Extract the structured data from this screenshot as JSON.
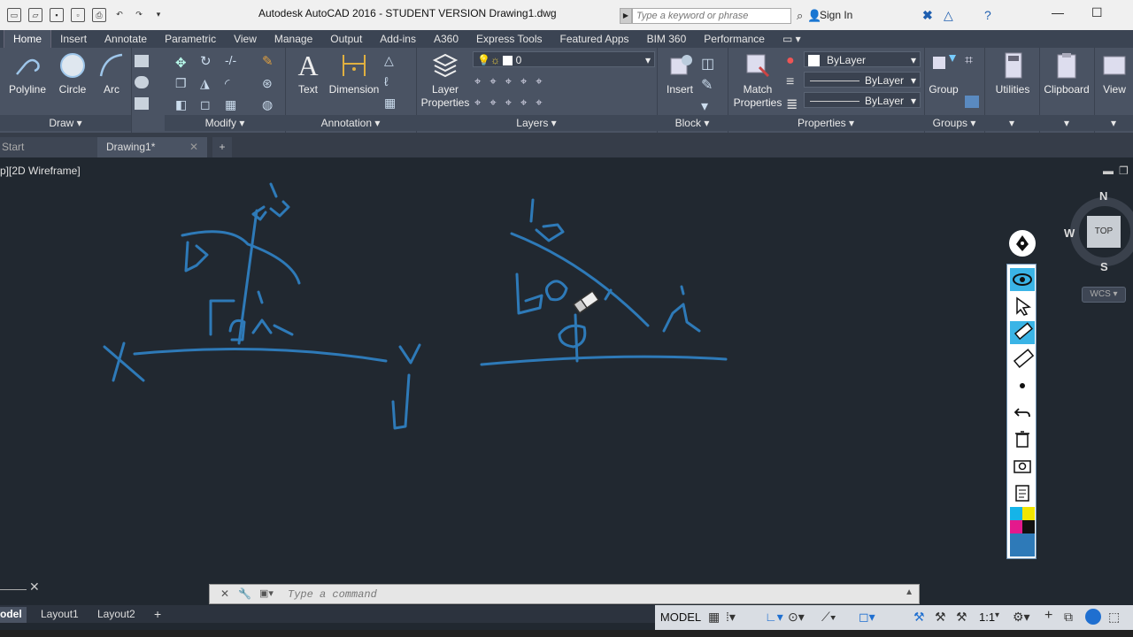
{
  "window": {
    "title": "Autodesk AutoCAD 2016 - STUDENT VERSION    Drawing1.dwg",
    "search_placeholder": "Type a keyword or phrase",
    "sign_in": "Sign In"
  },
  "ribbon_tabs": [
    "Home",
    "Insert",
    "Annotate",
    "Parametric",
    "View",
    "Manage",
    "Output",
    "Add-ins",
    "A360",
    "Express Tools",
    "Featured Apps",
    "BIM 360",
    "Performance"
  ],
  "panels": {
    "draw": {
      "title": "Draw",
      "tools": [
        "Polyline",
        "Circle",
        "Arc"
      ]
    },
    "modify": {
      "title": "Modify"
    },
    "annotation": {
      "title": "Annotation",
      "tools": [
        "Text",
        "Dimension"
      ]
    },
    "layers": {
      "title": "Layers",
      "tool_line1": "Layer",
      "tool_line2": "Properties",
      "current_layer": "0"
    },
    "block": {
      "title": "Block",
      "tool": "Insert"
    },
    "properties": {
      "title": "Properties",
      "tool_line1": "Match",
      "tool_line2": "Properties",
      "color": "ByLayer",
      "linetype": "ByLayer",
      "lineweight": "ByLayer"
    },
    "groups": {
      "title": "Groups",
      "tool": "Group"
    },
    "utilities": {
      "tool": "Utilities"
    },
    "clipboard": {
      "tool": "Clipboard"
    },
    "view": {
      "tool": "View"
    }
  },
  "doc_tabs": {
    "start": "Start",
    "drawing": "Drawing1*"
  },
  "viewport_label": "p][2D Wireframe]",
  "viewcube": {
    "n": "N",
    "w": "W",
    "s": "S",
    "top": "TOP",
    "wcs": "WCS"
  },
  "command": {
    "placeholder": "Type a command"
  },
  "layout_tabs": [
    "odel",
    "Layout1",
    "Layout2"
  ],
  "status": {
    "model": "MODEL",
    "scale": "1:1"
  },
  "colors": {
    "ink": "#2e7ab8",
    "canvas": "#212830",
    "ribbon": "#4a5363"
  }
}
